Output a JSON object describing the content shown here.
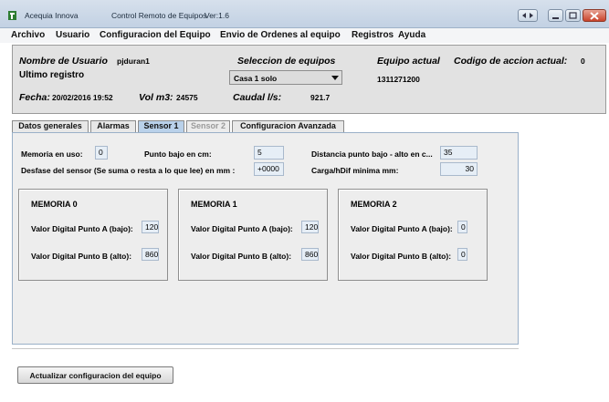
{
  "window": {
    "app_name": "Acequia Innova",
    "title": "Control Remoto de Equipos",
    "version": "Ver:1.6"
  },
  "menu": [
    "Archivo",
    "Usuario",
    "Configuracion del Equipo",
    "Envio de Ordenes al equipo",
    "Registros",
    "Ayuda"
  ],
  "info": {
    "user_label": "Nombre de Usuario",
    "user_value": "pjduran1",
    "last_record_label": "Ultimo registro",
    "selection_label": "Seleccion de equipos",
    "selection_value": "Casa 1 solo",
    "equipo_label": "Equipo actual",
    "equipo_value": "1311271200",
    "codigo_label": "Codigo de accion actual:",
    "codigo_value": "0",
    "fecha_label": "Fecha:",
    "fecha_value": "20/02/2016 19:52",
    "vol_label": "Vol m3:",
    "vol_value": "24575",
    "caudal_label": "Caudal l/s:",
    "caudal_value": "921.7"
  },
  "tabs": [
    "Datos generales",
    "Alarmas",
    "Sensor 1",
    "Sensor 2",
    "Configuracion Avanzada"
  ],
  "sensor": {
    "memoria_label": "Memoria en uso:",
    "memoria_value": "0",
    "punto_bajo_label": "Punto bajo en cm:",
    "punto_bajo_value": "5",
    "distancia_label": "Distancia punto bajo - alto en c...",
    "distancia_value": "35",
    "desfase_label": "Desfase del sensor (Se suma o resta a lo que lee) en mm :",
    "desfase_value": "+0000",
    "carga_label": "Carga/hDif minima mm:",
    "carga_value": "30"
  },
  "memories": [
    {
      "title": "MEMORIA 0",
      "a_label": "Valor Digital Punto A (bajo):",
      "a_value": "120",
      "b_label": "Valor Digital Punto B (alto):",
      "b_value": "860"
    },
    {
      "title": "MEMORIA 1",
      "a_label": "Valor Digital Punto A (bajo):",
      "a_value": "120",
      "b_label": "Valor Digital Punto B (alto):",
      "b_value": "860"
    },
    {
      "title": "MEMORIA 2",
      "a_label": "Valor Digital Punto A (bajo):",
      "a_value": "0",
      "b_label": "Valor Digital Punto B (alto):",
      "b_value": "0"
    }
  ],
  "actions": {
    "update_label": "Actualizar configuracion del equipo"
  },
  "colors": {
    "active_tab": "#b9d1ea",
    "close_button": "#c9432b"
  }
}
